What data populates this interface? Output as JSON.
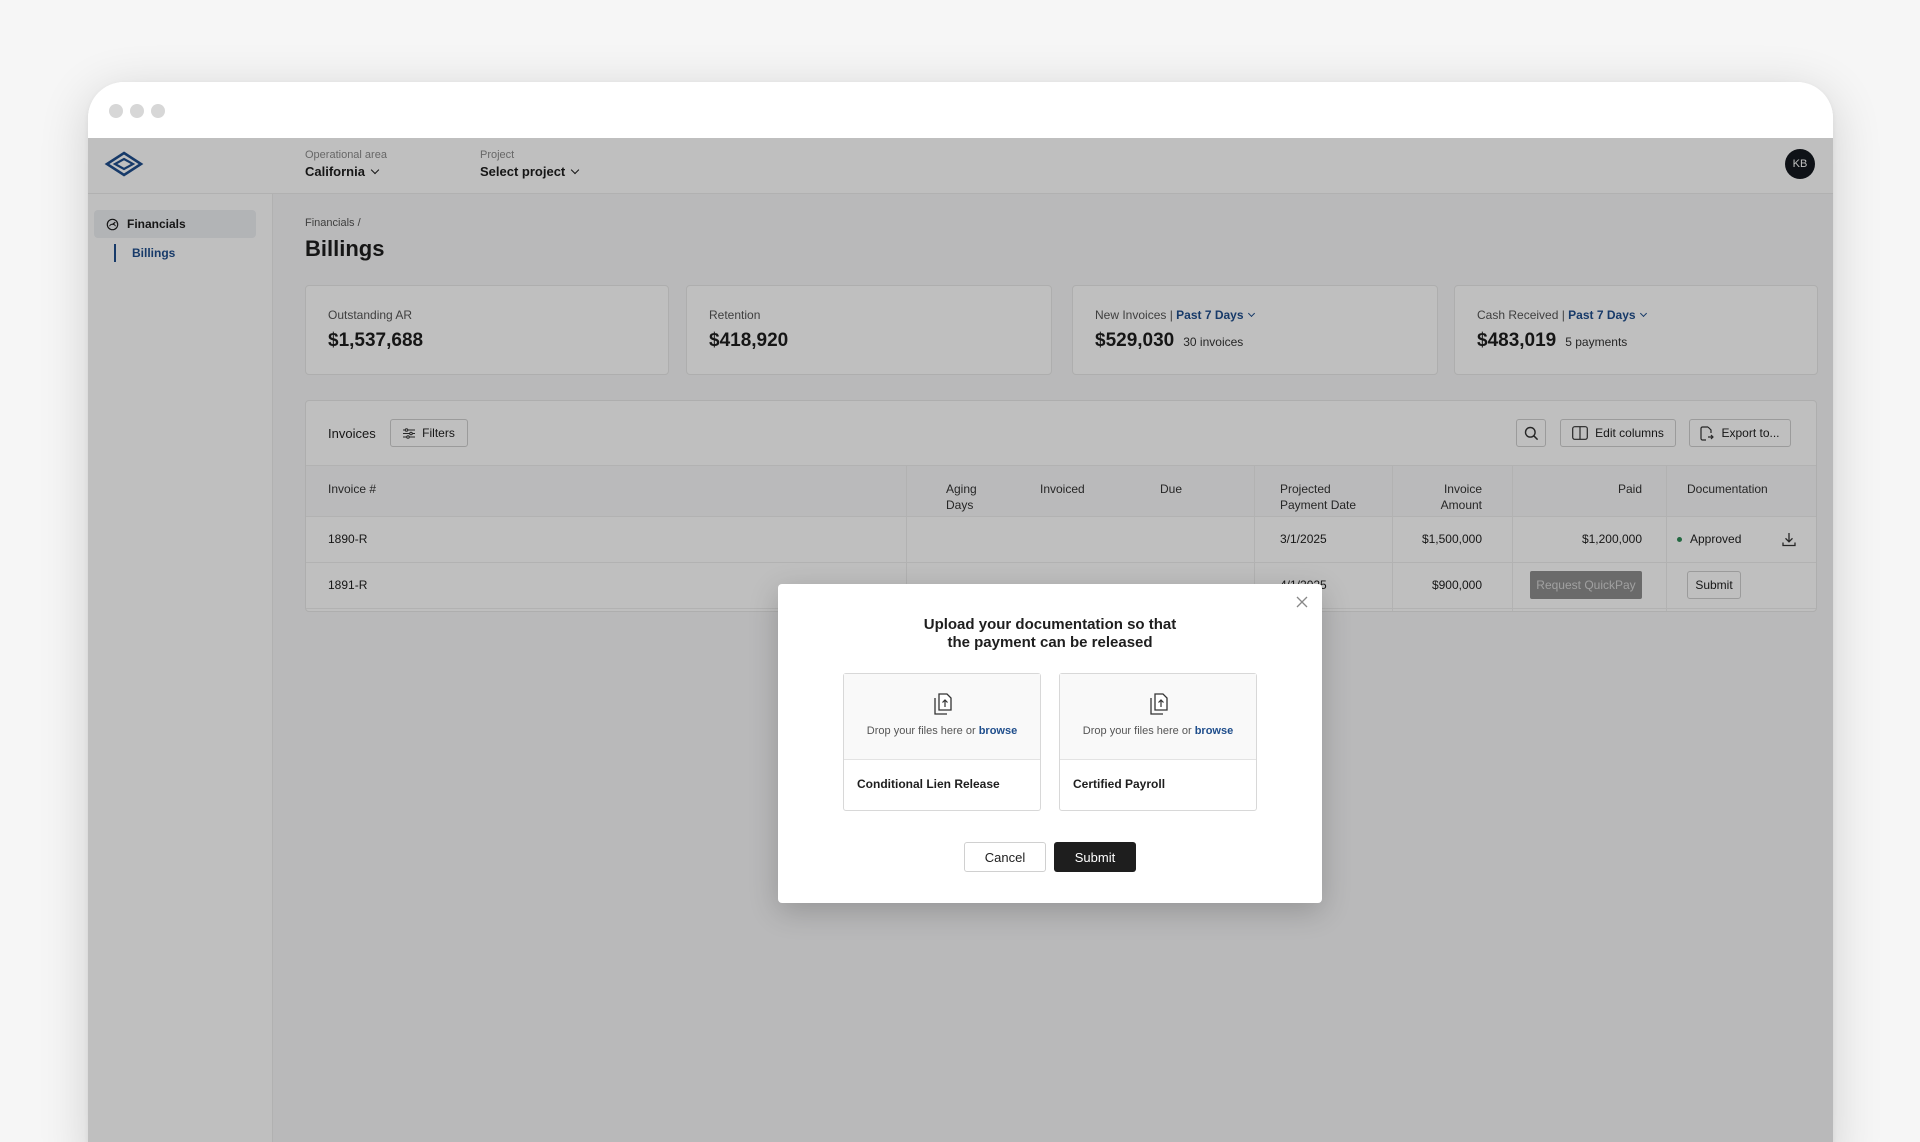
{
  "header": {
    "operational_area": {
      "label": "Operational area",
      "value": "California"
    },
    "project": {
      "label": "Project",
      "value": "Select project"
    },
    "avatar_initials": "KB"
  },
  "sidebar": {
    "items": [
      {
        "label": "Financials",
        "icon": "chart-gauge-icon"
      },
      {
        "label": "Billings"
      }
    ]
  },
  "page": {
    "breadcrumb": "Financials /",
    "title": "Billings"
  },
  "cards": [
    {
      "label": "Outstanding AR",
      "value": "$1,537,688"
    },
    {
      "label": "Retention",
      "value": "$418,920"
    },
    {
      "label": "New Invoices |",
      "link": "Past 7 Days",
      "value": "$529,030",
      "note": "30 invoices"
    },
    {
      "label": "Cash Received |",
      "link": "Past 7 Days",
      "value": "$483,019",
      "note": "5 payments"
    }
  ],
  "toolbar": {
    "invoices_label": "Invoices",
    "filters_label": "Filters",
    "edit_columns_label": "Edit columns",
    "export_label": "Export to..."
  },
  "table": {
    "headers": {
      "invoice": "Invoice #",
      "aging": "Aging Days",
      "invoiced": "Invoiced",
      "due": "Due",
      "projected": "Projected Payment Date",
      "amount": "Invoice Amount",
      "paid": "Paid",
      "documentation": "Documentation"
    },
    "rows": [
      {
        "invoice": "1890-R",
        "projected": "3/1/2025",
        "amount": "$1,500,000",
        "paid": "$1,200,000",
        "documentation": "Approved"
      },
      {
        "invoice": "1891-R",
        "projected": "4/1/2025",
        "amount": "$900,000",
        "quickpay": "Request QuickPay",
        "documentation": "Submit"
      }
    ]
  },
  "modal": {
    "title_line1": "Upload your documentation so that",
    "title_line2": "the payment can be released",
    "drop_text": "Drop your files here or",
    "browse": "browse",
    "zones": [
      {
        "name": "Conditional Lien Release"
      },
      {
        "name": "Certified Payroll"
      }
    ],
    "cancel_label": "Cancel",
    "submit_label": "Submit"
  },
  "colors": {
    "accent": "#1f4e8c",
    "primary_button": "#1e1e1e",
    "approved": "#2e8b57"
  }
}
